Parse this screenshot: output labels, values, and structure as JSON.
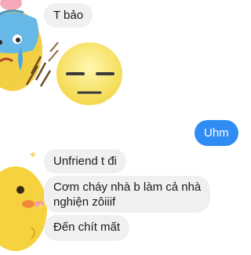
{
  "messages": [
    {
      "id": "m1",
      "sender": "them",
      "text": "T bảo"
    },
    {
      "id": "m2",
      "sender": "them",
      "type": "sticker",
      "sticker": "expressionless-face-sticker"
    },
    {
      "id": "m3",
      "sender": "me",
      "text": "Uhm"
    },
    {
      "id": "m4",
      "sender": "them",
      "text": "Unfriend t đi"
    },
    {
      "id": "m5",
      "sender": "them",
      "lines": [
        "Cơm cháy nhà b làm cả nhà",
        "nghiện zôiiif"
      ]
    },
    {
      "id": "m6",
      "sender": "them",
      "text": "Đến chít mất"
    }
  ],
  "avatars": {
    "top": "sweating-cartoon-avatar",
    "bottom": "yellow-chick-cartoon-avatar"
  },
  "colors": {
    "outgoing_bubble": "#2f8cf4",
    "incoming_bubble": "#f0f0f0"
  }
}
